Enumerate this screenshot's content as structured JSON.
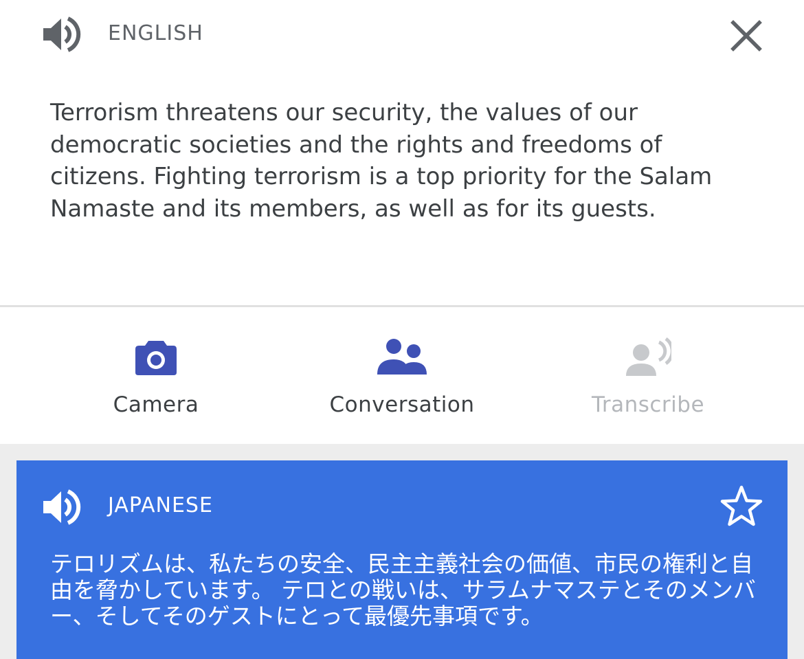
{
  "source": {
    "language": "ENGLISH",
    "speaker_icon": "volume-up-icon",
    "close_icon": "close-icon",
    "text": "Terrorism threatens our security, the values of our democratic societies and the rights and freedoms of citizens. Fighting terrorism is a top priority for the Salam Namaste and its members, as well as for its guests."
  },
  "tools": [
    {
      "label": "Camera",
      "icon": "camera-icon",
      "enabled": true
    },
    {
      "label": "Conversation",
      "icon": "people-icon",
      "enabled": true
    },
    {
      "label": "Transcribe",
      "icon": "voice-person-icon",
      "enabled": false
    }
  ],
  "translation": {
    "language": "JAPANESE",
    "speaker_icon": "volume-up-icon",
    "star_icon": "star-outline-icon",
    "text": "テロリズムは、私たちの安全、民主主義社会の価値、市民の権利と自由を脅かしています。 テロとの戦いは、サラムナマステとそのメンバー、そしてそのゲストにとって最優先事項です。"
  },
  "colors": {
    "accent": "#3871e0",
    "icon_active": "#3f51b5",
    "icon_disabled": "#c7c9cc",
    "text_primary": "#3c4043",
    "text_secondary": "#5f6368",
    "background": "#ededed"
  }
}
